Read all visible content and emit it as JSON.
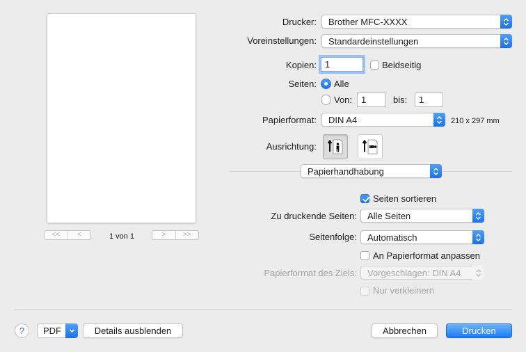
{
  "preview": {
    "nav_first": "<<",
    "nav_prev": "<",
    "nav_next": ">",
    "nav_last": ">>",
    "page_count": "1 von 1"
  },
  "printer": {
    "label": "Drucker:",
    "value": "Brother MFC-XXXX"
  },
  "presets": {
    "label": "Voreinstellungen:",
    "value": "Standardeinstellungen"
  },
  "copies": {
    "label": "Kopien:",
    "value": "1",
    "duplex_label": "Beidseitig",
    "duplex_checked": false
  },
  "pages": {
    "label": "Seiten:",
    "all_label": "Alle",
    "all_selected": true,
    "from_label": "Von:",
    "from_value": "1",
    "to_label": "bis:",
    "to_value": "1"
  },
  "paper_size": {
    "label": "Papierformat:",
    "value": "DIN A4",
    "dimensions": "210 x 297 mm"
  },
  "orientation": {
    "label": "Ausrichtung:",
    "selected": "portrait"
  },
  "section_menu": {
    "value": "Papierhandhabung"
  },
  "paper_handling": {
    "collate_label": "Seiten sortieren",
    "collate_checked": true,
    "pages_to_print_label": "Zu druckende Seiten:",
    "pages_to_print_value": "Alle Seiten",
    "page_order_label": "Seitenfolge:",
    "page_order_value": "Automatisch",
    "scale_to_fit_label": "An Papierformat anpassen",
    "scale_to_fit_checked": false,
    "dest_paper_label": "Papierformat des Ziels:",
    "dest_paper_value": "Vorgeschlagen: DIN A4",
    "scale_down_only_label": "Nur verkleinern"
  },
  "bottom": {
    "help": "?",
    "pdf": "PDF",
    "hide_details": "Details ausblenden",
    "cancel": "Abbrechen",
    "print": "Drucken"
  },
  "colors": {
    "accent": "#1b71e8"
  }
}
